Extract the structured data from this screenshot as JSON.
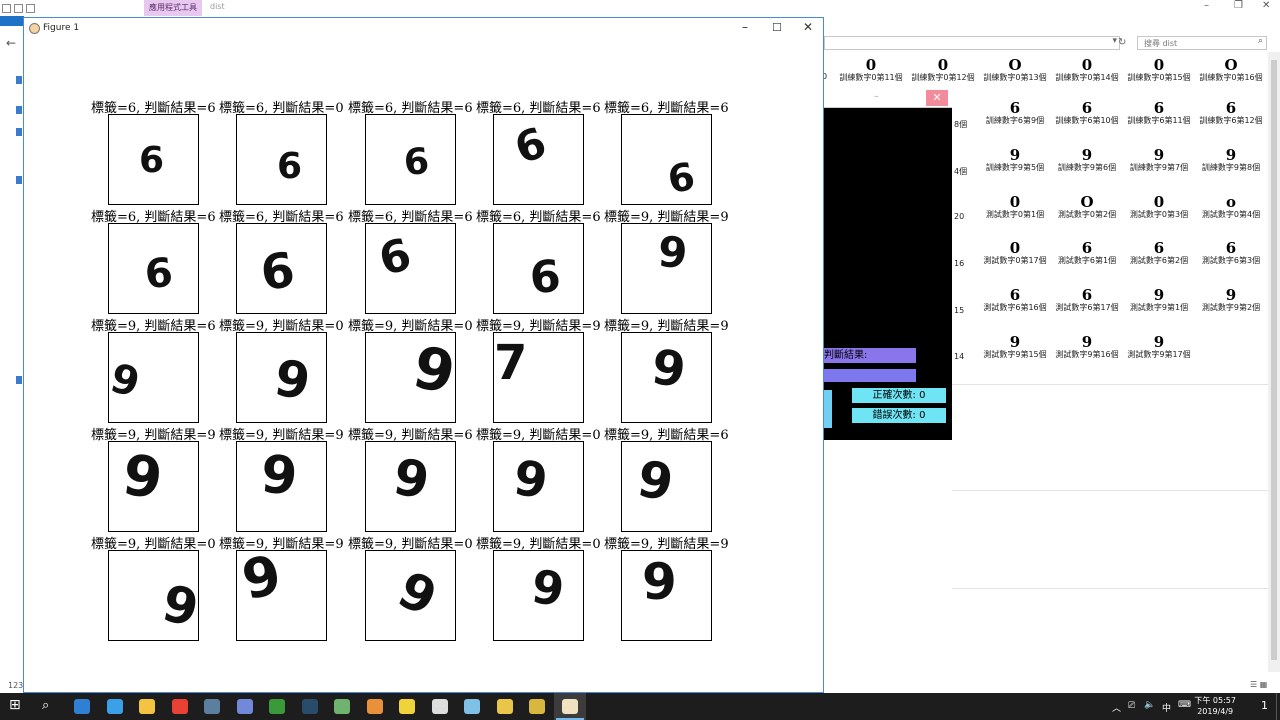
{
  "explorer": {
    "ribbon_context_tab": "應用程式工具",
    "ribbon_location": "dist",
    "search_placeholder": "搜尋 dist",
    "status_count": "123",
    "files": [
      {
        "name": "訓練數字0第11個",
        "digit": "0"
      },
      {
        "name": "訓練數字0第12個",
        "digit": "0"
      },
      {
        "name": "訓練數字0第13個",
        "digit": "O"
      },
      {
        "name": "訓練數字0第14個",
        "digit": "0"
      },
      {
        "name": "訓練數字0第15個",
        "digit": "0"
      },
      {
        "name": "訓練數字0第16個",
        "digit": "O"
      },
      {
        "name": "訓練數字6第9個",
        "digit": "6"
      },
      {
        "name": "訓練數字6第10個",
        "digit": "6"
      },
      {
        "name": "訓練數字6第11個",
        "digit": "6"
      },
      {
        "name": "訓練數字6第12個",
        "digit": "6"
      },
      {
        "name": "訓練數字9第5個",
        "digit": "9"
      },
      {
        "name": "訓練數字9第6個",
        "digit": "9"
      },
      {
        "name": "訓練數字9第7個",
        "digit": "9"
      },
      {
        "name": "訓練數字9第8個",
        "digit": "9"
      },
      {
        "name": "測試數字0第1個",
        "digit": "0"
      },
      {
        "name": "測試數字0第2個",
        "digit": "O"
      },
      {
        "name": "測試數字0第3個",
        "digit": "0"
      },
      {
        "name": "測試數字0第4個",
        "digit": "o"
      },
      {
        "name": "測試數字0第17個",
        "digit": "0"
      },
      {
        "name": "測試數字6第1個",
        "digit": "6"
      },
      {
        "name": "測試數字6第2個",
        "digit": "6"
      },
      {
        "name": "測試數字6第3個",
        "digit": "6"
      },
      {
        "name": "測試數字6第16個",
        "digit": "6"
      },
      {
        "name": "測試數字6第17個",
        "digit": "6"
      },
      {
        "name": "測試數字9第1個",
        "digit": "9"
      },
      {
        "name": "測試數字9第2個",
        "digit": "9"
      },
      {
        "name": "測試數字9第15個",
        "digit": "9"
      },
      {
        "name": "測試數字9第16個",
        "digit": "9"
      },
      {
        "name": "測試數字9第17個",
        "digit": "9"
      }
    ],
    "partial_labels": [
      "0",
      "8個",
      "4個",
      "20",
      "16",
      "15",
      "14"
    ]
  },
  "dark_app": {
    "result_label": "判斷結果:",
    "correct_count": "正確次數: 0",
    "wrong_count": "錯誤次數: 0"
  },
  "figure": {
    "window_title": "Figure 1",
    "rows": [
      {
        "titles": [
          "標籤=6, 判斷結果=6",
          "標籤=6, 判斷結果=0",
          "標籤=6, 判斷結果=6",
          "標籤=6, 判斷結果=6",
          "標籤=6, 判斷結果=6"
        ],
        "digits": [
          "6",
          "6",
          "6",
          "6",
          "6"
        ]
      },
      {
        "titles": [
          "標籤=6, 判斷結果=6",
          "標籤=6, 判斷結果=6",
          "標籤=6, 判斷結果=6",
          "標籤=6, 判斷結果=6",
          "標籤=9, 判斷結果=9"
        ],
        "digits": [
          "6",
          "6",
          "6",
          "6",
          "9"
        ]
      },
      {
        "titles": [
          "標籤=9, 判斷結果=6",
          "標籤=9, 判斷結果=0",
          "標籤=9, 判斷結果=0",
          "標籤=9, 判斷結果=9",
          "標籤=9, 判斷結果=9"
        ],
        "digits": [
          "9",
          "9",
          "9",
          "7",
          "9"
        ]
      },
      {
        "titles": [
          "標籤=9, 判斷結果=9",
          "標籤=9, 判斷結果=9",
          "標籤=9, 判斷結果=6",
          "標籤=9, 判斷結果=0",
          "標籤=9, 判斷結果=6"
        ],
        "digits": [
          "9",
          "9",
          "9",
          "9",
          "9"
        ]
      },
      {
        "titles": [
          "標籤=9, 判斷結果=0",
          "標籤=9, 判斷結果=9",
          "標籤=9, 判斷結果=0",
          "標籤=9, 判斷結果=0",
          "標籤=9, 判斷結果=9"
        ],
        "digits": [
          "9",
          "9",
          "9",
          "9",
          "9"
        ]
      }
    ]
  },
  "taskbar": {
    "clock_time": "下午 05:57",
    "clock_date": "2019/4/9",
    "ime": "中",
    "notification_count": "1",
    "apps": [
      {
        "name": "edge",
        "color": "#2f7fd3"
      },
      {
        "name": "ie",
        "color": "#3aa0e8"
      },
      {
        "name": "folder",
        "color": "#f3c442"
      },
      {
        "name": "chrome",
        "color": "#e94235"
      },
      {
        "name": "steam",
        "color": "#5c7e9f"
      },
      {
        "name": "discord",
        "color": "#7289da"
      },
      {
        "name": "xbox",
        "color": "#3a9a3a"
      },
      {
        "name": "lightroom",
        "color": "#2a4c6b"
      },
      {
        "name": "notepad",
        "color": "#6fb36f"
      },
      {
        "name": "media",
        "color": "#e8913a"
      },
      {
        "name": "sticky",
        "color": "#f0d33a"
      },
      {
        "name": "obs",
        "color": "#dddddd"
      },
      {
        "name": "app-blue",
        "color": "#7fc1e6"
      },
      {
        "name": "python",
        "color": "#e9c64a"
      },
      {
        "name": "python2",
        "color": "#d8b640"
      },
      {
        "name": "figure",
        "color": "#f0e2c0"
      }
    ]
  }
}
